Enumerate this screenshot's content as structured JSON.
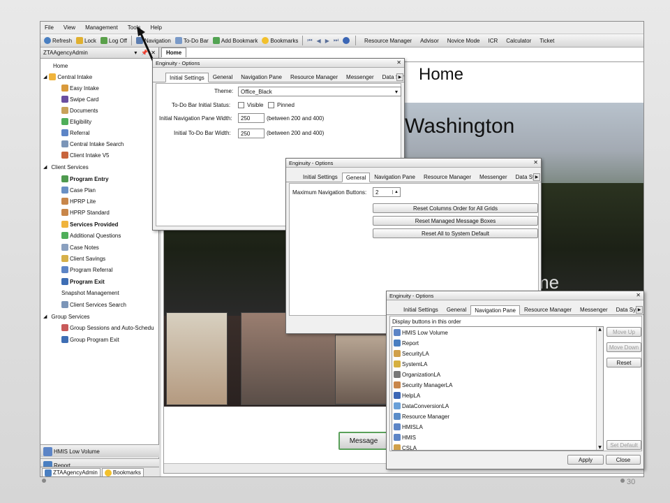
{
  "menu": [
    "File",
    "View",
    "Management",
    "Tools",
    "Help"
  ],
  "toolbar": {
    "refresh": "Refresh",
    "lock": "Lock",
    "logoff": "Log Off",
    "navigation": "Navigation",
    "todo": "To-Do Bar",
    "add_bookmark": "Add Bookmark",
    "bookmarks": "Bookmarks",
    "right": [
      "Resource Manager",
      "Advisor",
      "Novice Mode",
      "ICR",
      "Calculator",
      "Ticket"
    ]
  },
  "nav": {
    "agency": "ZTAAgencyAdmin",
    "home": "Home",
    "central_intake": "Central Intake",
    "central_items": [
      "Easy Intake",
      "Swipe Card",
      "Documents",
      "Eligibility",
      "Referral",
      "Central Intake Search",
      "Client Intake V5"
    ],
    "client_services": "Client Services",
    "client_items": [
      "Program Entry",
      "Case Plan",
      "HPRP Lite",
      "HPRP Standard",
      "Services Provided",
      "Additional Questions",
      "Case Notes",
      "Client Savings",
      "Program Referral",
      "Program Exit",
      "Snapshot Management",
      "Client Services Search"
    ],
    "group_services": "Group Services",
    "group_items": [
      "Group Sessions and Auto-Schedu",
      "Group Program Exit"
    ],
    "bottom_hmis": "HMIS Low Volume",
    "bottom_report": "Report",
    "tab_agency": "ZTAAgencyAdmin",
    "tab_bookmarks": "Bookmarks"
  },
  "content": {
    "home_tab": "Home",
    "hero_home": "Home",
    "hero_washington": "Washington",
    "hero_me": "me",
    "message_button": "Message"
  },
  "dialog1": {
    "title": "Enginuity - Options",
    "tabs": [
      "Initial Settings",
      "General",
      "Navigation Pane",
      "Resource Manager",
      "Messenger",
      "Data Syn"
    ],
    "theme_label": "Theme:",
    "theme_value": "Office_Black",
    "todo_status_label": "To-Do Bar Initial Status:",
    "visible": "Visible",
    "pinned": "Pinned",
    "nav_width_label": "Initial Navigation Pane Width:",
    "nav_width_value": "250",
    "nav_width_hint": "(between 200 and 400)",
    "todo_width_label": "Initial To-Do Bar Width:",
    "todo_width_value": "250",
    "todo_width_hint": "(between 200 and 400)"
  },
  "dialog2": {
    "title": "Enginuity - Options",
    "tabs": [
      "Initial Settings",
      "General",
      "Navigation Pane",
      "Resource Manager",
      "Messenger",
      "Data Syn"
    ],
    "max_nav_label": "Maximum Navigation Buttons:",
    "max_nav_value": "2",
    "btn_reset_columns": "Reset Columns Order for All Grids",
    "btn_reset_boxes": "Reset Managed Message Boxes",
    "btn_reset_all": "Reset All to System Default"
  },
  "dialog3": {
    "title": "Enginuity - Options",
    "tabs": [
      "Initial Settings",
      "General",
      "Navigation Pane",
      "Resource Manager",
      "Messenger",
      "Data Syn"
    ],
    "display_label": "Display buttons in this order",
    "items": [
      "HMIS Low Volume",
      "Report",
      "SecurityLA",
      "SystemLA",
      "OrganizationLA",
      "Security ManagerLA",
      "HelpLA",
      "DataConversionLA",
      "Resource Manager",
      "HMISLA",
      "HMIS",
      "CSLA"
    ],
    "move_up": "Move Up",
    "move_down": "Move Down",
    "reset": "Reset",
    "set_default": "Set Default",
    "apply": "Apply",
    "close": "Close"
  },
  "slide_number": "30"
}
